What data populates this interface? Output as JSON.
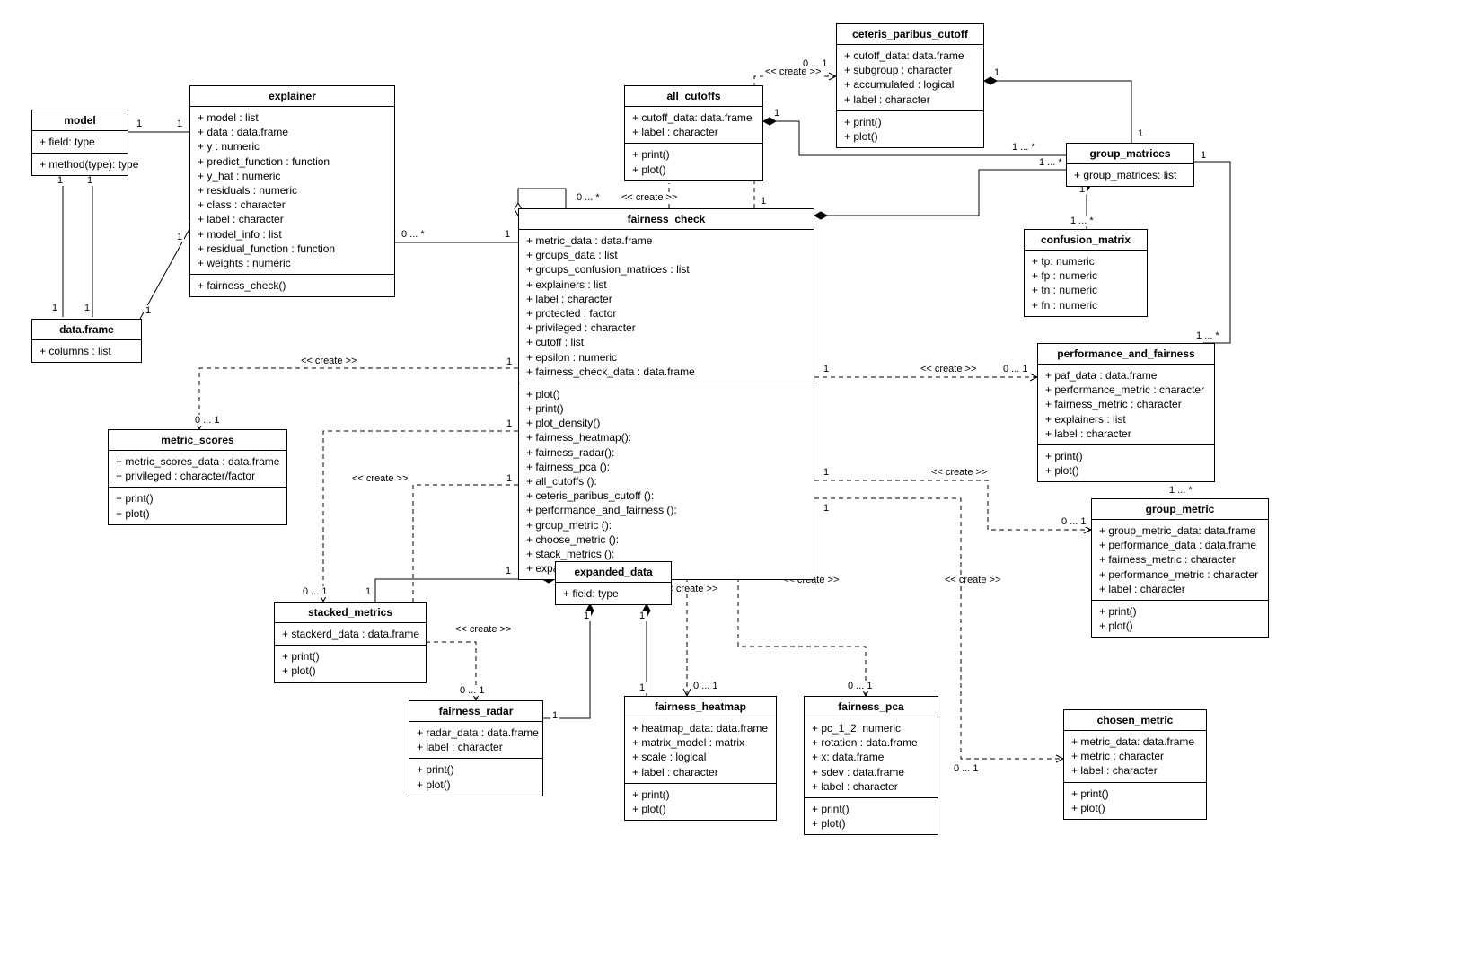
{
  "classes": {
    "model": {
      "title": "model",
      "attrs": [
        "+ field: type"
      ],
      "ops": [
        "+ method(type): type"
      ]
    },
    "dataframe": {
      "title": "data.frame",
      "attrs": [
        "+ columns : list"
      ]
    },
    "explainer": {
      "title": "explainer",
      "attrs": [
        "+ model : list",
        "+ data : data.frame",
        "+ y : numeric",
        "+ predict_function : function",
        "+ y_hat : numeric",
        "+ residuals : numeric",
        "+ class : character",
        "+ label : character",
        "+ model_info : list",
        "+ residual_function : function",
        "+ weights : numeric"
      ],
      "ops": [
        "+ fairness_check()"
      ]
    },
    "fairness_check": {
      "title": "fairness_check",
      "attrs": [
        "+ metric_data : data.frame",
        "+ groups_data : list",
        "+ groups_confusion_matrices : list",
        "+ explainers : list",
        "+ label : character",
        "+ protected : factor",
        "+ privileged : character",
        "+ cutoff : list",
        "+ epsilon : numeric",
        "+ fairness_check_data : data.frame"
      ],
      "ops": [
        "+ plot()",
        "+ print()",
        "+ plot_density()",
        "+ fairness_heatmap():",
        "+ fairness_radar():",
        "+ fairness_pca ():",
        "+ all_cutoffs ():",
        "+ ceteris_paribus_cutoff ():",
        "+ performance_and_fairness ():",
        "+ group_metric ():",
        "+ choose_metric ():",
        "+ stack_metrics ():",
        "+ expand_fairness_object ():"
      ]
    },
    "all_cutoffs": {
      "title": "all_cutoffs",
      "attrs": [
        "+ cutoff_data: data.frame",
        "+ label : character"
      ],
      "ops": [
        "+ print()",
        "+ plot()"
      ]
    },
    "ceteris_paribus_cutoff": {
      "title": "ceteris_paribus_cutoff",
      "attrs": [
        "+ cutoff_data: data.frame",
        "+ subgroup : character",
        "+ accumulated : logical",
        "+ label : character"
      ],
      "ops": [
        "+ print()",
        "+ plot()"
      ]
    },
    "group_matrices": {
      "title": "group_matrices",
      "attrs": [
        "+ group_matrices: list"
      ]
    },
    "confusion_matrix": {
      "title": "confusion_matrix",
      "attrs": [
        "+ tp: numeric",
        "+ fp : numeric",
        "+ tn : numeric",
        "+ fn : numeric"
      ]
    },
    "performance_and_fairness": {
      "title": "performance_and_fairness",
      "attrs": [
        "+ paf_data : data.frame",
        "+ performance_metric : character",
        "+ fairness_metric : character",
        "+ explainers : list",
        "+ label : character"
      ],
      "ops": [
        "+ print()",
        "+ plot()"
      ]
    },
    "group_metric": {
      "title": "group_metric",
      "attrs": [
        "+ group_metric_data: data.frame",
        "+ performance_data : data.frame",
        "+ fairness_metric : character",
        "+ performance_metric : character",
        "+ label : character"
      ],
      "ops": [
        "+ print()",
        "+ plot()"
      ]
    },
    "chosen_metric": {
      "title": "chosen_metric",
      "attrs": [
        "+ metric_data: data.frame",
        "+ metric : character",
        "+ label : character"
      ],
      "ops": [
        "+ print()",
        "+ plot()"
      ]
    },
    "metric_scores": {
      "title": "metric_scores",
      "attrs": [
        "+ metric_scores_data : data.frame",
        "+ privileged : character/factor"
      ],
      "ops": [
        "+ print()",
        "+ plot()"
      ]
    },
    "stacked_metrics": {
      "title": "stacked_metrics",
      "attrs": [
        "+ stackerd_data : data.frame"
      ],
      "ops": [
        "+ print()",
        "+ plot()"
      ]
    },
    "fairness_radar": {
      "title": "fairness_radar",
      "attrs": [
        "+ radar_data : data.frame",
        "+ label : character"
      ],
      "ops": [
        "+ print()",
        "+ plot()"
      ]
    },
    "expanded_data": {
      "title": "expanded_data",
      "attrs": [
        "+ field: type"
      ]
    },
    "fairness_heatmap": {
      "title": "fairness_heatmap",
      "attrs": [
        "+ heatmap_data: data.frame",
        "+ matrix_model : matrix",
        "+ scale : logical",
        "+ label : character"
      ],
      "ops": [
        "+ print()",
        "+ plot()"
      ]
    },
    "fairness_pca": {
      "title": "fairness_pca",
      "attrs": [
        "+ pc_1_2: numeric",
        "+ rotation : data.frame",
        "+ x: data.frame",
        "+ sdev : data.frame",
        "+ label : character"
      ],
      "ops": [
        "+ print()",
        "+ plot()"
      ]
    }
  },
  "labels": {
    "create": "<< create >>",
    "one": "1",
    "zero_star": "0 ... *",
    "zero_one": "0 ... 1",
    "one_star": "1 ... *"
  }
}
